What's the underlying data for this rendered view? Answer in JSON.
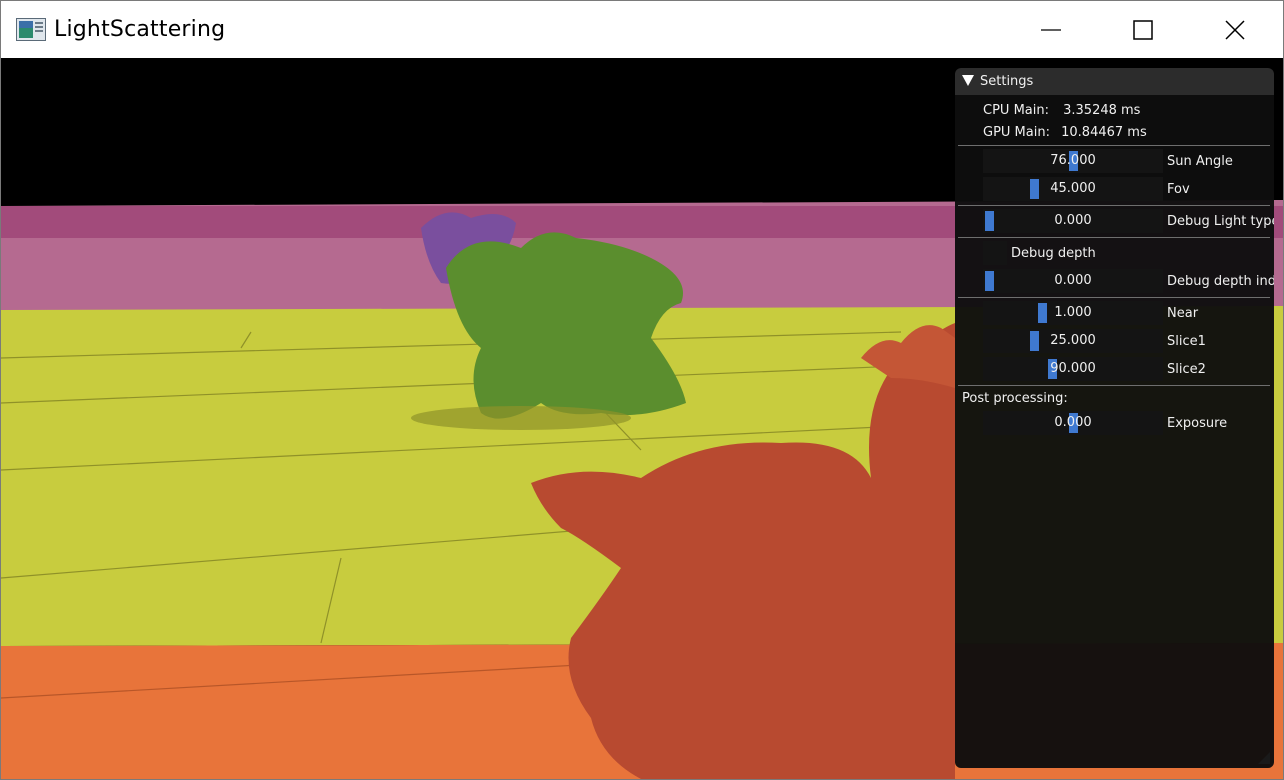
{
  "window": {
    "title": "LightScattering",
    "controls": {
      "minimize": "minimize-icon",
      "maximize": "maximize-icon",
      "close": "close-icon"
    }
  },
  "settings": {
    "header": "Settings",
    "stats": [
      {
        "label": "CPU Main:",
        "value": "3.35248 ms"
      },
      {
        "label": "GPU Main:",
        "value": "10.84467 ms"
      }
    ],
    "sliders": {
      "sun_angle": {
        "label": "Sun Angle",
        "value": "76.000",
        "fraction": 0.5
      },
      "fov": {
        "label": "Fov",
        "value": "45.000",
        "fraction": 0.27
      },
      "debug_light": {
        "label": "Debug Light type",
        "value": "0.000",
        "fraction": 0.0
      },
      "debug_index": {
        "label": "Debug depth inde",
        "value": "0.000",
        "fraction": 0.0
      },
      "near": {
        "label": "Near",
        "value": "1.000",
        "fraction": 0.32
      },
      "slice1": {
        "label": "Slice1",
        "value": "25.000",
        "fraction": 0.27
      },
      "slice2": {
        "label": "Slice2",
        "value": "90.000",
        "fraction": 0.38
      },
      "exposure": {
        "label": "Exposure",
        "value": "0.000",
        "fraction": 0.5
      }
    },
    "debug_depth": {
      "label": "Debug depth",
      "checked": false
    },
    "post_processing_label": "Post processing:",
    "colors": {
      "grab": "#3f79d0",
      "panel_bg": "#0e0e0e",
      "header_bg": "#2c2c2c"
    }
  }
}
